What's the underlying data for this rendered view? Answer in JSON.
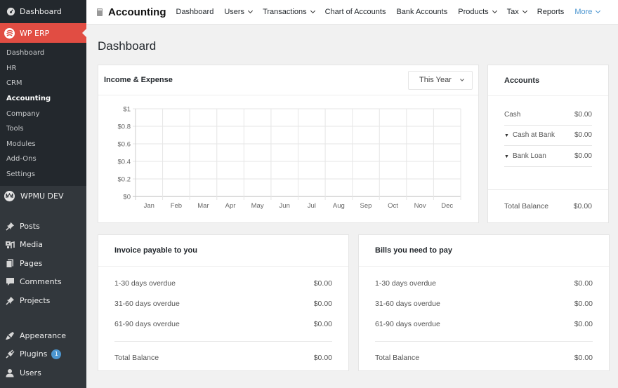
{
  "sidebar": {
    "top_item": {
      "label": "Dashboard",
      "icon": "dashboard-gauge-icon"
    },
    "active_item": {
      "label": "WP ERP",
      "icon": "wp-erp-logo-icon"
    },
    "submenu": [
      {
        "label": "Dashboard"
      },
      {
        "label": "HR"
      },
      {
        "label": "CRM"
      },
      {
        "label": "Accounting",
        "current": true
      },
      {
        "label": "Company"
      },
      {
        "label": "Tools"
      },
      {
        "label": "Modules"
      },
      {
        "label": "Add-Ons"
      },
      {
        "label": "Settings"
      }
    ],
    "wpmu": {
      "label": "WPMU DEV",
      "icon": "wpmu-dev-logo-icon"
    },
    "items": [
      {
        "label": "Posts",
        "icon": "pushpin-icon"
      },
      {
        "label": "Media",
        "icon": "media-icon"
      },
      {
        "label": "Pages",
        "icon": "pages-icon"
      },
      {
        "label": "Comments",
        "icon": "comment-icon"
      },
      {
        "label": "Projects",
        "icon": "pushpin-icon"
      },
      {
        "label": "Appearance",
        "icon": "paintbrush-icon"
      },
      {
        "label": "Plugins",
        "icon": "plugin-icon",
        "badge": "1"
      },
      {
        "label": "Users",
        "icon": "user-icon"
      }
    ]
  },
  "topnav": {
    "brand": "Accounting",
    "items": [
      {
        "label": "Dashboard",
        "dropdown": false
      },
      {
        "label": "Users",
        "dropdown": true
      },
      {
        "label": "Transactions",
        "dropdown": true
      },
      {
        "label": "Chart of Accounts",
        "dropdown": false
      },
      {
        "label": "Bank Accounts",
        "dropdown": false
      },
      {
        "label": "Products",
        "dropdown": true
      },
      {
        "label": "Tax",
        "dropdown": true
      },
      {
        "label": "Reports",
        "dropdown": false
      },
      {
        "label": "More",
        "dropdown": true
      }
    ],
    "accent_color": "#4c96d0"
  },
  "page": {
    "title": "Dashboard"
  },
  "income_expense": {
    "title": "Income & Expense",
    "period_select": "This Year"
  },
  "chart_data": {
    "type": "line",
    "title": "Income & Expense",
    "categories": [
      "Jan",
      "Feb",
      "Mar",
      "Apr",
      "May",
      "Jun",
      "Jul",
      "Aug",
      "Sep",
      "Oct",
      "Nov",
      "Dec"
    ],
    "series": [],
    "y_ticks": [
      "$0",
      "$0.2",
      "$0.4",
      "$0.6",
      "$0.8",
      "$1"
    ],
    "y_tick_values": [
      0,
      0.2,
      0.4,
      0.6,
      0.8,
      1
    ],
    "ylim": [
      0,
      1
    ],
    "xlabel": "",
    "ylabel": "",
    "grid": true
  },
  "accounts": {
    "title": "Accounts",
    "rows": [
      {
        "label": "Cash",
        "value": "$0.00",
        "expandable": false
      },
      {
        "label": "Cash at Bank",
        "value": "$0.00",
        "expandable": true
      },
      {
        "label": "Bank Loan",
        "value": "$0.00",
        "expandable": true
      }
    ],
    "total_label": "Total Balance",
    "total_value": "$0.00"
  },
  "invoice_payable": {
    "title": "Invoice payable to you",
    "rows": [
      {
        "label": "1-30 days overdue",
        "value": "$0.00"
      },
      {
        "label": "31-60 days overdue",
        "value": "$0.00"
      },
      {
        "label": "61-90 days overdue",
        "value": "$0.00"
      }
    ],
    "total_label": "Total Balance",
    "total_value": "$0.00"
  },
  "bills_to_pay": {
    "title": "Bills you need to pay",
    "rows": [
      {
        "label": "1-30 days overdue",
        "value": "$0.00"
      },
      {
        "label": "31-60 days overdue",
        "value": "$0.00"
      },
      {
        "label": "61-90 days overdue",
        "value": "$0.00"
      }
    ],
    "total_label": "Total Balance",
    "total_value": "$0.00"
  }
}
